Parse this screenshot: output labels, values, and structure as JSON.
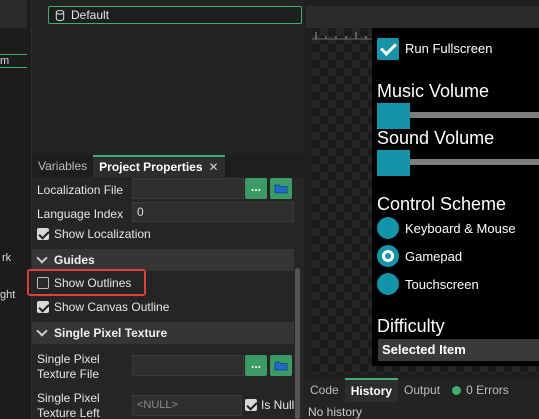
{
  "left_strip": {
    "rows": [
      "m",
      "rk",
      "ght"
    ]
  },
  "tree": {
    "item_label": "Default"
  },
  "tabs": {
    "variables": "Variables",
    "project_properties": "Project Properties",
    "close": "✕"
  },
  "props": {
    "localization_file_label": "Localization File",
    "language_index_label": "Language Index",
    "language_index_value": "0",
    "show_localization_label": "Show Localization",
    "guides_section": "Guides",
    "show_outlines_label": "Show Outlines",
    "show_canvas_outline_label": "Show Canvas Outline",
    "single_pixel_texture_section": "Single Pixel Texture",
    "single_pixel_texture_file_label_1": "Single Pixel",
    "single_pixel_texture_file_label_2": "Texture File",
    "single_pixel_texture_left_label_1": "Single Pixel",
    "single_pixel_texture_left_label_2": "Texture Left",
    "null_value": "<NULL>",
    "is_null_label": "Is Null",
    "browse_label": "...",
    "show_localization_checked": true,
    "show_outlines_checked": false,
    "show_canvas_outline_checked": true,
    "is_null_checked": true
  },
  "preview": {
    "run_fullscreen": "Run Fullscreen",
    "music_volume": "Music Volume",
    "sound_volume": "Sound Volume",
    "control_scheme": "Control Scheme",
    "keyboard_mouse": "Keyboard & Mouse",
    "gamepad": "Gamepad",
    "touchscreen": "Touchscreen",
    "difficulty": "Difficulty",
    "selected_item": "Selected Item",
    "selected_control_scheme": "Gamepad",
    "accent_color": "#1593a8"
  },
  "bottom": {
    "code": "Code",
    "history": "History",
    "output": "Output",
    "errors": "0 Errors",
    "no_history": "No history"
  },
  "colors": {
    "accent_green": "#3fae71",
    "highlight_red": "#e0403a"
  }
}
